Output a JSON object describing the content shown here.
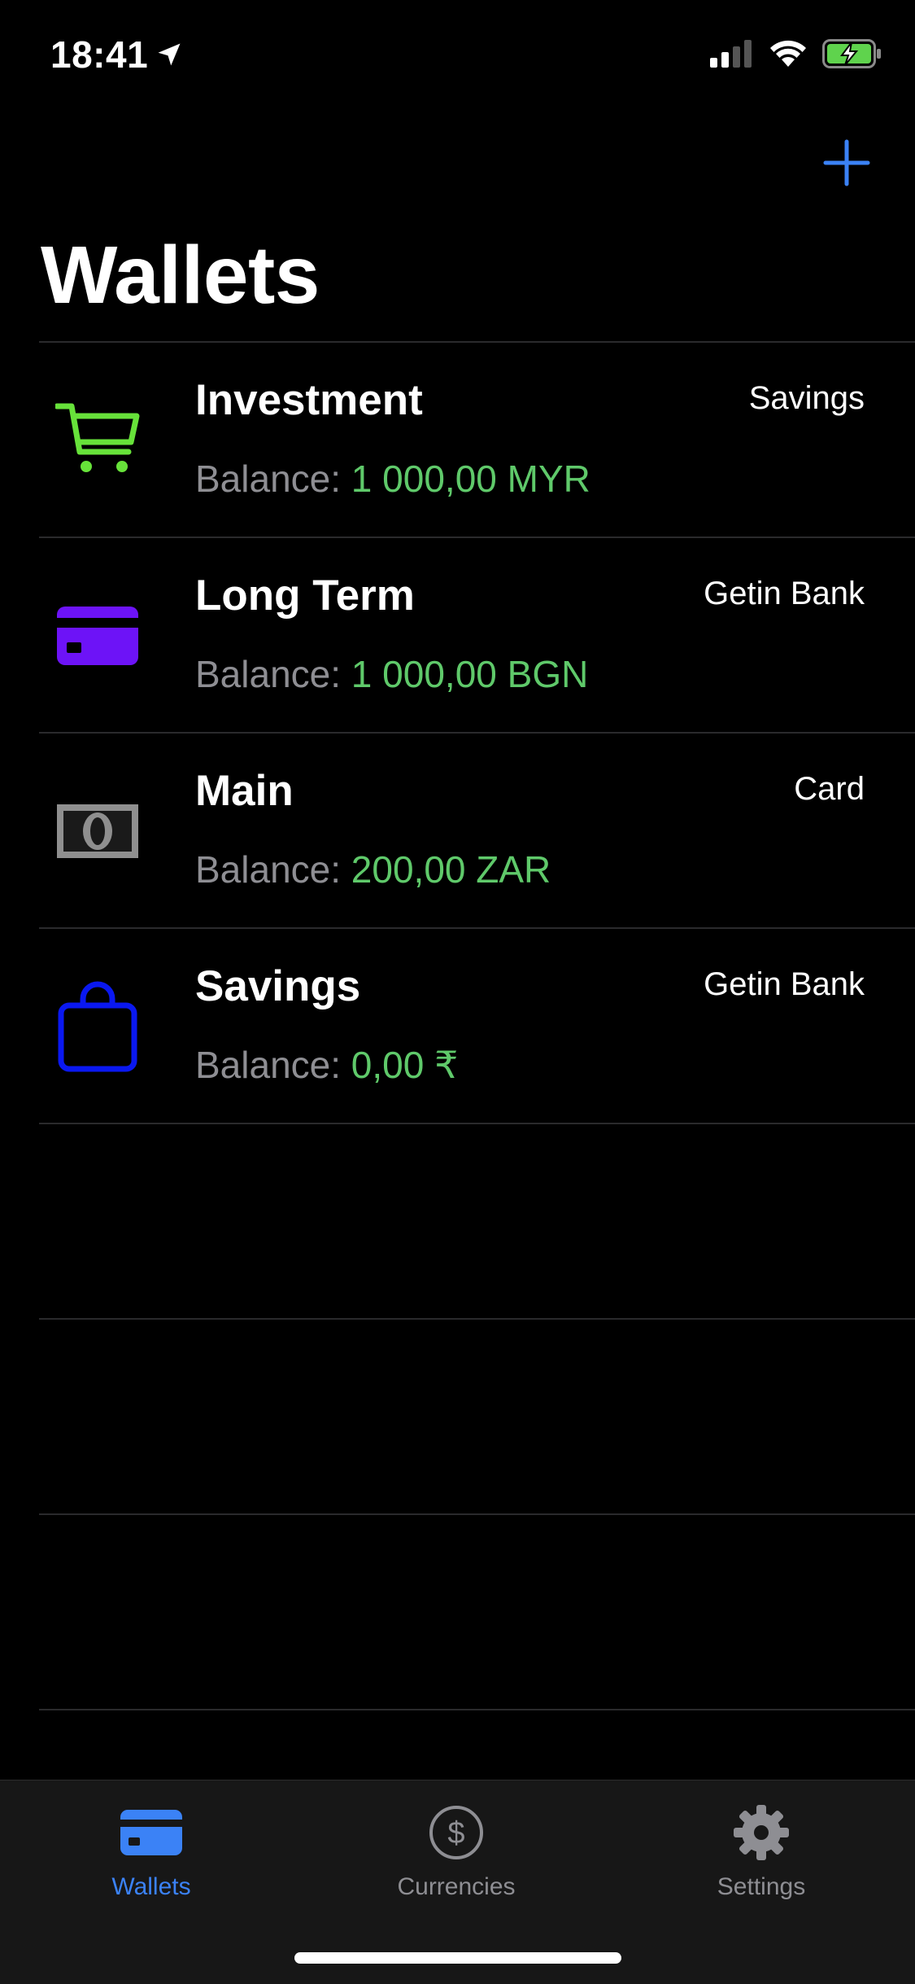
{
  "status_bar": {
    "time": "18:41"
  },
  "header": {
    "title": "Wallets",
    "add_icon": "plus-icon"
  },
  "colors": {
    "accent": "#3b82f6",
    "balance_green": "#5fc96a",
    "secondary_text": "#8e8e93"
  },
  "wallets": [
    {
      "name": "Investment",
      "type": "Savings",
      "balance_label": "Balance: ",
      "balance_value": "1 000,00 MYR",
      "icon": "shopping-cart-icon",
      "icon_color": "#67e23a"
    },
    {
      "name": "Long Term",
      "type": "Getin Bank",
      "balance_label": "Balance: ",
      "balance_value": "1 000,00 BGN",
      "icon": "credit-card-icon",
      "icon_color": "#6d13f7"
    },
    {
      "name": "Main",
      "type": "Card",
      "balance_label": "Balance: ",
      "balance_value": "200,00 ZAR",
      "icon": "banknote-icon",
      "icon_color": "#8f8f8f"
    },
    {
      "name": "Savings",
      "type": "Getin Bank",
      "balance_label": "Balance: ",
      "balance_value": "0,00 ₹",
      "icon": "shopping-bag-icon",
      "icon_color": "#0a18f0"
    }
  ],
  "tab_bar": {
    "tabs": [
      {
        "label": "Wallets",
        "icon": "credit-card-icon",
        "active": true
      },
      {
        "label": "Currencies",
        "icon": "dollar-circle-icon",
        "active": false
      },
      {
        "label": "Settings",
        "icon": "gear-icon",
        "active": false
      }
    ]
  }
}
